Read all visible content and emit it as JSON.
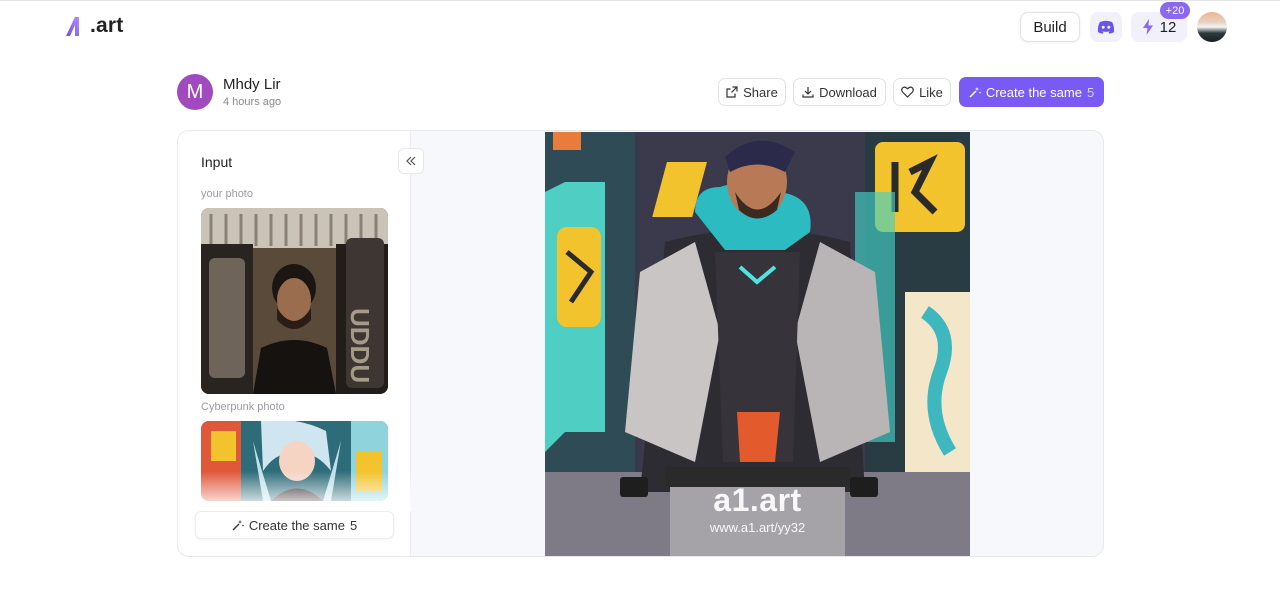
{
  "header": {
    "logo_text": ".art",
    "build_label": "Build",
    "credits_value": "12",
    "credits_bonus": "+20",
    "icons": [
      "logo-icon",
      "discord-icon",
      "lightning-icon",
      "user-avatar"
    ]
  },
  "post": {
    "author_initial": "M",
    "author_name": "Mhdy Lir",
    "time_ago": "4 hours ago",
    "share_label": "Share",
    "download_label": "Download",
    "like_label": "Like",
    "create_label": "Create the same",
    "create_count": "5"
  },
  "sidebar": {
    "title": "Input",
    "your_photo_label": "your photo",
    "style_label": "Cyberpunk photo",
    "create_label": "Create the same",
    "create_count": "5"
  },
  "result": {
    "watermark": "a1.art",
    "watermark_url": "www.a1.art/yy32"
  },
  "colors": {
    "accent": "#7a5af5",
    "avatar_bg": "#a14ac0"
  }
}
